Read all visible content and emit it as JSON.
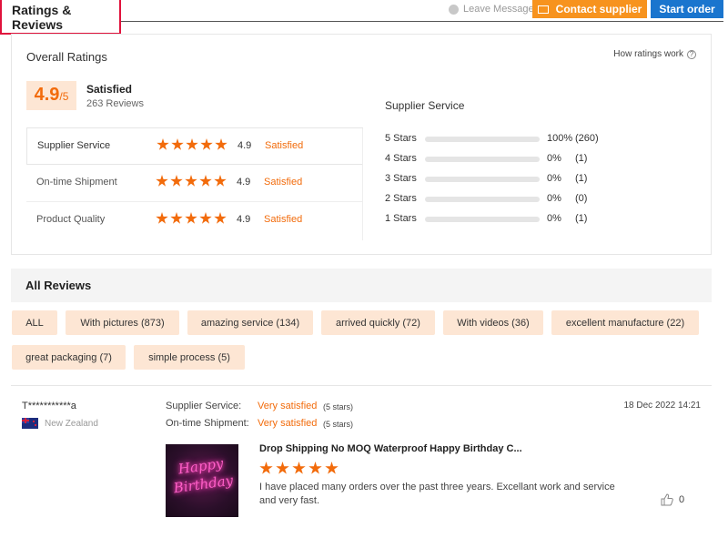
{
  "header": {
    "title": "Ratings & Reviews",
    "leave_messages": "Leave Messages",
    "contact_supplier": "Contact supplier",
    "start_order": "Start order"
  },
  "overall": {
    "title": "Overall Ratings",
    "how_ratings": "How ratings work",
    "score": "4.9",
    "score_suffix": "/5",
    "satisfaction": "Satisfied",
    "review_count": "263 Reviews",
    "rows": [
      {
        "label": "Supplier Service",
        "value": "4.9",
        "status": "Satisfied",
        "stars": 5
      },
      {
        "label": "On-time Shipment",
        "value": "4.9",
        "status": "Satisfied",
        "stars": 5
      },
      {
        "label": "Product Quality",
        "value": "4.9",
        "status": "Satisfied",
        "stars": 5
      }
    ]
  },
  "supplier_service": {
    "title": "Supplier Service",
    "rows": [
      {
        "label": "5  Stars",
        "percent": "100%",
        "count": "(260)",
        "fill": 1.0
      },
      {
        "label": "4  Stars",
        "percent": "0%",
        "count": "(1)",
        "fill": 0
      },
      {
        "label": "3  Stars",
        "percent": "0%",
        "count": "(1)",
        "fill": 0
      },
      {
        "label": "2  Stars",
        "percent": "0%",
        "count": "(0)",
        "fill": 0
      },
      {
        "label": "1  Stars",
        "percent": "0%",
        "count": "(1)",
        "fill": 0
      }
    ]
  },
  "all_reviews": {
    "title": "All Reviews",
    "filters": [
      "ALL",
      "With pictures (873)",
      "amazing service (134)",
      "arrived quickly (72)",
      "With videos (36)",
      "excellent manufacture (22)",
      "great packaging (7)",
      "simple process (5)"
    ]
  },
  "review": {
    "reviewer": "T***********a",
    "country": "New Zealand",
    "supplier_service_label": "Supplier Service:",
    "supplier_service_value": "Very satisfied",
    "supplier_service_note": "(5 stars)",
    "shipment_label": "On-time Shipment:",
    "shipment_value": "Very satisfied",
    "shipment_note": "(5 stars)",
    "date": "18 Dec 2022 14:21",
    "product_title": "Drop Shipping No MOQ Waterproof Happy Birthday C...",
    "thumb_text": "Happy Birthday",
    "stars": 5,
    "text": "I have placed many orders over the past three years. Excellant work and service and very fast.",
    "likes": "0"
  },
  "colors": {
    "accent": "#f26b0b",
    "contact_button": "#f7931e",
    "start_button": "#1a75ce",
    "chip_bg": "#fde6d4"
  }
}
